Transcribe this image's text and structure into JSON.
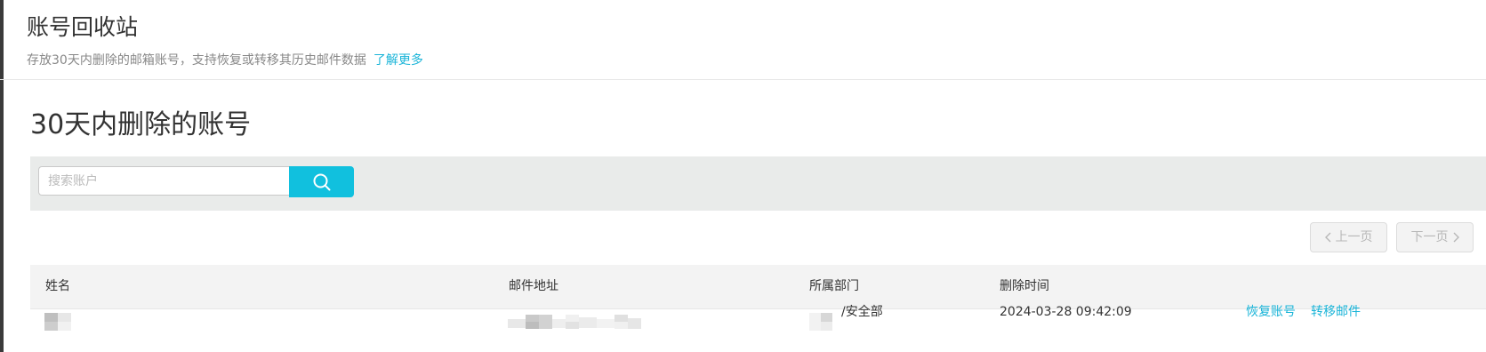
{
  "header": {
    "title": "账号回收站",
    "description": "存放30天内删除的邮箱账号，支持恢复或转移其历史邮件数据",
    "learn_more": "了解更多"
  },
  "section": {
    "title": "30天内删除的账号"
  },
  "search": {
    "placeholder": "搜索账户",
    "value": "",
    "button_icon": "search-icon"
  },
  "pagination": {
    "prev_label": "上一页",
    "next_label": "下一页",
    "prev_icon": "chevron-left-icon",
    "next_icon": "chevron-right-icon",
    "prev_enabled": false,
    "next_enabled": false
  },
  "table": {
    "columns": [
      "姓名",
      "邮件地址",
      "所属部门",
      "删除时间"
    ],
    "rows": [
      {
        "name": "",
        "email": "",
        "department": "/安全部",
        "deleted_at": "2024-03-28 09:42:09",
        "actions": [
          "恢复账号",
          "转移邮件"
        ]
      }
    ]
  },
  "colors": {
    "accent": "#11c0de",
    "link": "#19b4d8",
    "search_bar_bg": "#e9ebea",
    "table_header_bg": "#f3f3f3"
  }
}
